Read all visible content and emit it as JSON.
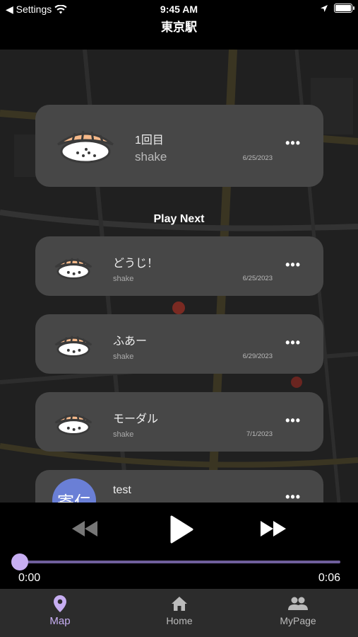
{
  "status_bar": {
    "back_label": "◀ Settings",
    "time": "9:45 AM"
  },
  "nav": {
    "title": "東京駅"
  },
  "now_playing": {
    "title": "1回目",
    "user": "shake",
    "date": "6/25/2023"
  },
  "play_next_label": "Play Next",
  "queue": [
    {
      "title": "どうじ！",
      "user": "shake",
      "date": "6/25/2023"
    },
    {
      "title": "ふあー",
      "user": "shake",
      "date": "6/29/2023"
    },
    {
      "title": "モーダル",
      "user": "shake",
      "date": "7/1/2023"
    },
    {
      "title": "test",
      "avatar_text": "寄仁"
    }
  ],
  "more_glyph": "•••",
  "player": {
    "time_elapsed": "0:00",
    "time_total": "0:06",
    "progress": 0.0
  },
  "tabs": [
    {
      "label": "Map",
      "icon": "map-pin-icon",
      "active": true
    },
    {
      "label": "Home",
      "icon": "home-icon",
      "active": false
    },
    {
      "label": "MyPage",
      "icon": "people-icon",
      "active": false
    }
  ],
  "colors": {
    "accent": "#c7aef2",
    "card": "#474747",
    "sushi_topping": "#f6b98a"
  }
}
